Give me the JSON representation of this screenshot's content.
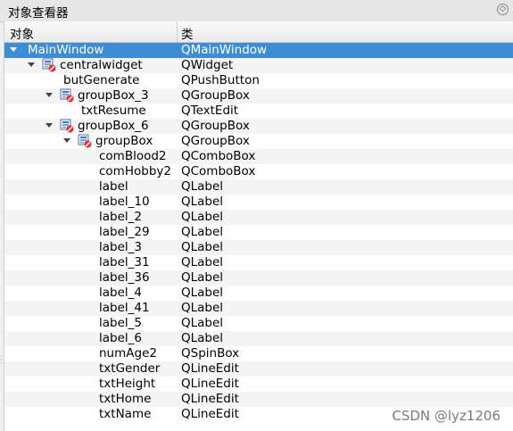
{
  "panel": {
    "title": "对象查看器",
    "float_icon": "restore-icon"
  },
  "header": {
    "col_object": "对象",
    "col_class": "类"
  },
  "rows": [
    {
      "name": "MainWindow",
      "class": "QMainWindow",
      "depth": 0,
      "expanded": true,
      "icon": false,
      "selected": true
    },
    {
      "name": "centralwidget",
      "class": "QWidget",
      "depth": 1,
      "expanded": true,
      "icon": true,
      "selected": false
    },
    {
      "name": "butGenerate",
      "class": "QPushButton",
      "depth": 2,
      "expanded": null,
      "icon": false,
      "selected": false
    },
    {
      "name": "groupBox_3",
      "class": "QGroupBox",
      "depth": 2,
      "expanded": true,
      "icon": true,
      "selected": false
    },
    {
      "name": "txtResume",
      "class": "QTextEdit",
      "depth": 3,
      "expanded": null,
      "icon": false,
      "selected": false
    },
    {
      "name": "groupBox_6",
      "class": "QGroupBox",
      "depth": 2,
      "expanded": true,
      "icon": true,
      "selected": false
    },
    {
      "name": "groupBox",
      "class": "QGroupBox",
      "depth": 3,
      "expanded": true,
      "icon": true,
      "selected": false
    },
    {
      "name": "comBlood2",
      "class": "QComboBox",
      "depth": 4,
      "expanded": null,
      "icon": false,
      "selected": false
    },
    {
      "name": "comHobby2",
      "class": "QComboBox",
      "depth": 4,
      "expanded": null,
      "icon": false,
      "selected": false
    },
    {
      "name": "label",
      "class": "QLabel",
      "depth": 4,
      "expanded": null,
      "icon": false,
      "selected": false
    },
    {
      "name": "label_10",
      "class": "QLabel",
      "depth": 4,
      "expanded": null,
      "icon": false,
      "selected": false
    },
    {
      "name": "label_2",
      "class": "QLabel",
      "depth": 4,
      "expanded": null,
      "icon": false,
      "selected": false
    },
    {
      "name": "label_29",
      "class": "QLabel",
      "depth": 4,
      "expanded": null,
      "icon": false,
      "selected": false
    },
    {
      "name": "label_3",
      "class": "QLabel",
      "depth": 4,
      "expanded": null,
      "icon": false,
      "selected": false
    },
    {
      "name": "label_31",
      "class": "QLabel",
      "depth": 4,
      "expanded": null,
      "icon": false,
      "selected": false
    },
    {
      "name": "label_36",
      "class": "QLabel",
      "depth": 4,
      "expanded": null,
      "icon": false,
      "selected": false
    },
    {
      "name": "label_4",
      "class": "QLabel",
      "depth": 4,
      "expanded": null,
      "icon": false,
      "selected": false
    },
    {
      "name": "label_41",
      "class": "QLabel",
      "depth": 4,
      "expanded": null,
      "icon": false,
      "selected": false
    },
    {
      "name": "label_5",
      "class": "QLabel",
      "depth": 4,
      "expanded": null,
      "icon": false,
      "selected": false
    },
    {
      "name": "label_6",
      "class": "QLabel",
      "depth": 4,
      "expanded": null,
      "icon": false,
      "selected": false
    },
    {
      "name": "numAge2",
      "class": "QSpinBox",
      "depth": 4,
      "expanded": null,
      "icon": false,
      "selected": false
    },
    {
      "name": "txtGender",
      "class": "QLineEdit",
      "depth": 4,
      "expanded": null,
      "icon": false,
      "selected": false
    },
    {
      "name": "txtHeight",
      "class": "QLineEdit",
      "depth": 4,
      "expanded": null,
      "icon": false,
      "selected": false
    },
    {
      "name": "txtHome",
      "class": "QLineEdit",
      "depth": 4,
      "expanded": null,
      "icon": false,
      "selected": false
    },
    {
      "name": "txtName",
      "class": "QLineEdit",
      "depth": 4,
      "expanded": null,
      "icon": false,
      "selected": false
    }
  ],
  "watermark": "CSDN @lyz1206",
  "colors": {
    "selection": "#3d8dd6",
    "alt_row": "#f4f4f4"
  }
}
